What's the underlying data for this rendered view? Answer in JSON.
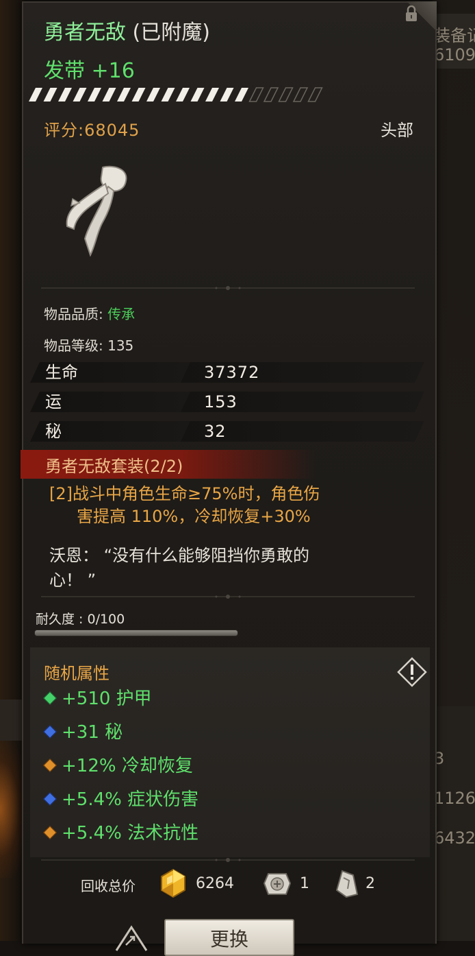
{
  "item": {
    "name": "勇者无敌",
    "enchant_tag": "(已附魔)",
    "type_line": "发带 +16",
    "enhance_progress_percent": 75,
    "score": "评分:68045",
    "slot": "头部",
    "icon": "headband-icon"
  },
  "properties": {
    "quality_label": "物品品质: ",
    "quality_value": "传承",
    "level": "物品等级: 135"
  },
  "stats": [
    {
      "name": "生命",
      "value": "37372"
    },
    {
      "name": "运",
      "value": "153"
    },
    {
      "name": "秘",
      "value": "32"
    }
  ],
  "set_bonus": {
    "title": "勇者无敌套装(2/2)",
    "line1": "[2]战斗中角色生命≥75%时，角色伤",
    "line2": "害提高 110%，冷却恢复+30%"
  },
  "flavor": {
    "line1": "沃恩：  “没有什么能够阻挡你勇敢的",
    "line2": "心！ ”"
  },
  "durability": {
    "label": "耐久度 : 0/100",
    "fraction": 0.0
  },
  "random_attributes": {
    "title": "随机属性",
    "items": [
      {
        "text": "+510 护甲",
        "gem": "green-gem-icon"
      },
      {
        "text": "+31 秘",
        "gem": "blue-gem-icon"
      },
      {
        "text": "+12% 冷却恢复",
        "gem": "orange-gem-icon"
      },
      {
        "text": "+5.4% 症状伤害",
        "gem": "blue-gem-icon"
      },
      {
        "text": "+5.4% 法术抗性",
        "gem": "orange-gem-icon"
      }
    ]
  },
  "recycle": {
    "label": "回收总价",
    "gold": "6264",
    "stone": "1",
    "shard": "2"
  },
  "actions": {
    "swap_label": "更换"
  },
  "background": {
    "right_text_1": "装备记",
    "right_text_2": "6109",
    "right_text_3": "3",
    "right_text_4": "1126",
    "right_text_5": "6432"
  },
  "colors": {
    "legendary_green": "#5fe06c",
    "gold": "#e8a646",
    "set_red": "#8a1a10"
  }
}
